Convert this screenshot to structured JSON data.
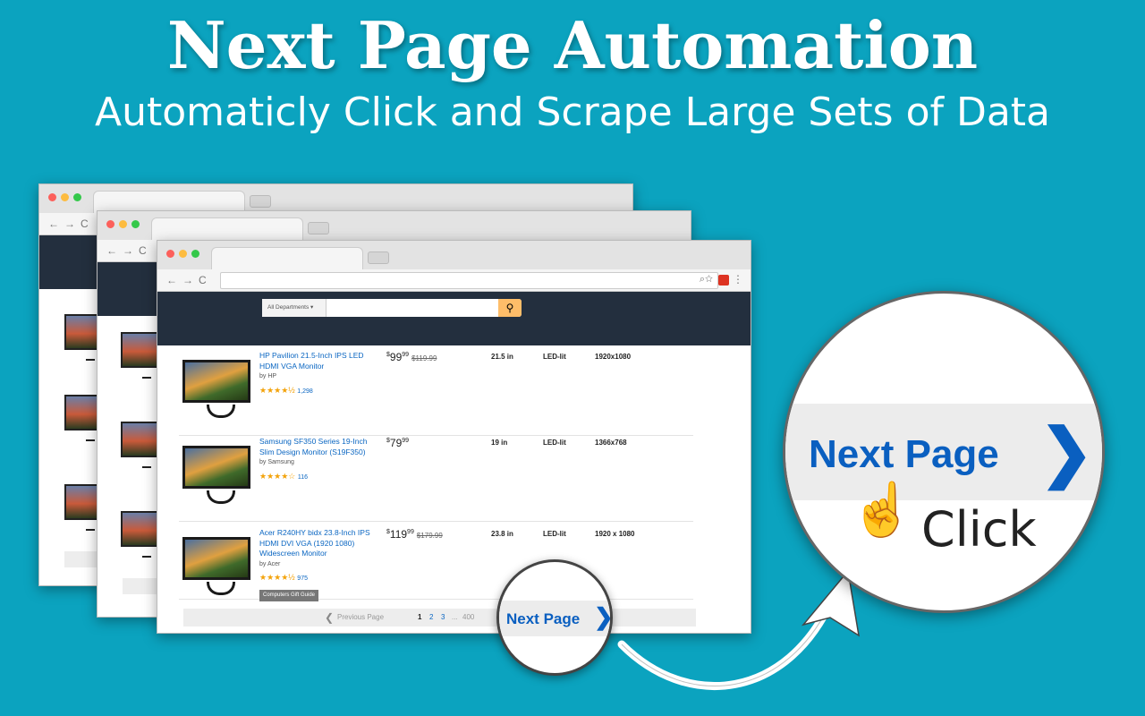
{
  "header": {
    "title": "Next Page Automation",
    "subtitle": "Automaticly Click and Scrape Large Sets of Data"
  },
  "browser": {
    "search_department": "All Departments",
    "search_icon": "magnifier-icon"
  },
  "products": [
    {
      "title": "HP Pavilion 21.5-Inch IPS LED HDMI VGA Monitor",
      "by": "by HP",
      "stars": "★★★★½",
      "reviews": "1,298",
      "price_whole": "99",
      "price_frac": "99",
      "list_price": "$119.99",
      "size": "21.5 in",
      "type": "LED-lit",
      "resolution": "1920x1080",
      "rating": 4.5
    },
    {
      "title": "Samsung SF350 Series 19-Inch Slim Design Monitor (S19F350)",
      "by": "by Samsung",
      "stars": "★★★★☆",
      "reviews": "116",
      "price_whole": "79",
      "price_frac": "99",
      "list_price": "",
      "size": "19 in",
      "type": "LED-lit",
      "resolution": "1366x768",
      "rating": 4
    },
    {
      "title": "Acer R240HY bidx 23.8-Inch IPS HDMI DVI VGA (1920 1080) Widescreen Monitor",
      "by": "by Acer",
      "stars": "★★★★½",
      "reviews": "975",
      "price_whole": "119",
      "price_frac": "99",
      "list_price": "$179.99",
      "size": "23.8 in",
      "type": "LED-lit",
      "resolution": "1920 x 1080",
      "badge": "Computers Gift Guide",
      "rating": 4.5
    }
  ],
  "pager": {
    "previous": "Previous Page",
    "pages": [
      "1",
      "2",
      "3"
    ],
    "ellipsis": "...",
    "last": "400",
    "next": "Next Page"
  },
  "callout": {
    "next": "Next Page",
    "click": "Click"
  },
  "colors": {
    "background": "#0ba3bf",
    "link": "#0a66c2",
    "header": "#232f3e",
    "search_button": "#febd69"
  }
}
